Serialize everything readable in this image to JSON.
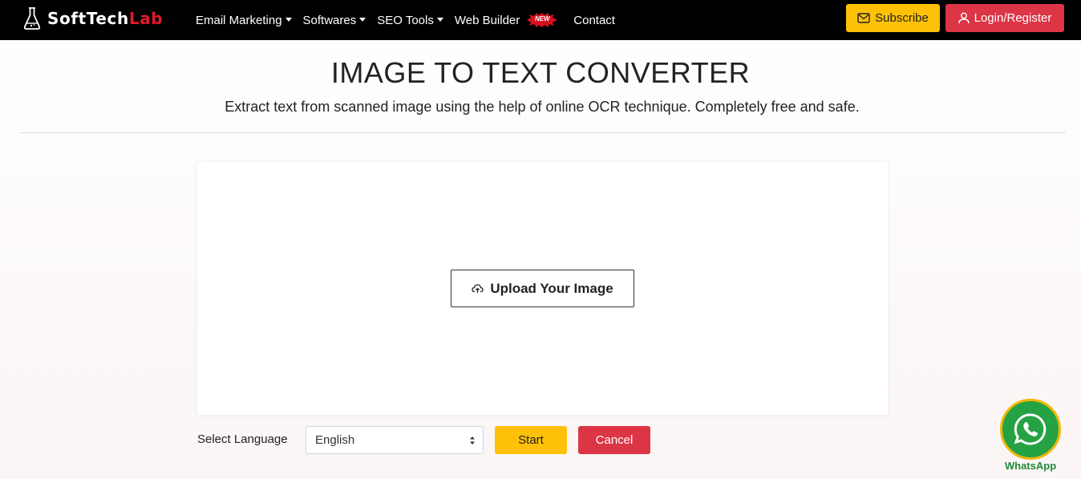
{
  "brand": {
    "name_part1": "SoftTech",
    "name_part2": "Lab"
  },
  "nav": {
    "items": [
      {
        "label": "Email Marketing",
        "dropdown": true
      },
      {
        "label": "Softwares",
        "dropdown": true
      },
      {
        "label": "SEO Tools",
        "dropdown": true
      },
      {
        "label": "Web Builder",
        "badge": "NEW"
      },
      {
        "label": "Contact"
      }
    ],
    "subscribe_label": "Subscribe",
    "login_label": "Login/Register"
  },
  "header": {
    "title": "IMAGE TO TEXT CONVERTER",
    "subtitle": "Extract text from scanned image using the help of online OCR technique. Completely free and safe."
  },
  "upload": {
    "button_label": "Upload Your Image",
    "icon": "cloud-upload-icon"
  },
  "controls": {
    "language_label": "Select Language",
    "language_value": "English",
    "start_label": "Start",
    "cancel_label": "Cancel"
  },
  "whatsapp": {
    "label": "WhatsApp",
    "icon": "whatsapp-icon"
  },
  "colors": {
    "navbar_bg": "#000000",
    "accent_yellow": "#ffc107",
    "accent_red": "#dc3545",
    "brand_red": "#e0182a",
    "whatsapp_green": "#25a244"
  }
}
